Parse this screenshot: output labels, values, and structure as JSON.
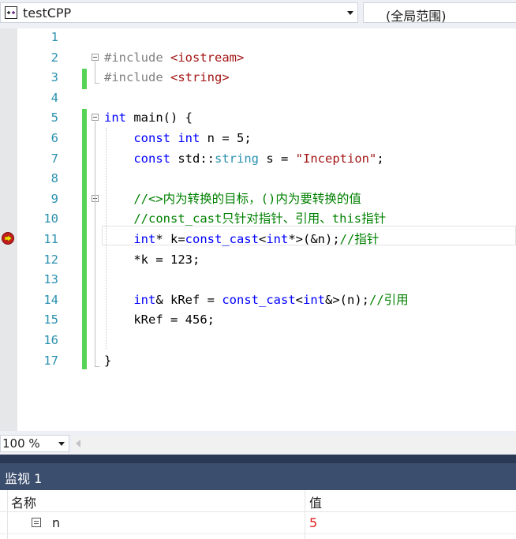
{
  "navigation": {
    "project": "testCPP",
    "scope": "(全局范围)"
  },
  "editor": {
    "lines": [
      {
        "num": "1",
        "tokens": []
      },
      {
        "num": "2",
        "tokens": [
          {
            "t": "#include ",
            "c": "p"
          },
          {
            "t": "<iostream>",
            "c": "s"
          }
        ]
      },
      {
        "num": "3",
        "tokens": [
          {
            "t": "#include ",
            "c": "p"
          },
          {
            "t": "<string>",
            "c": "s"
          }
        ]
      },
      {
        "num": "4",
        "tokens": []
      },
      {
        "num": "5",
        "tokens": [
          {
            "t": "int",
            "c": "k"
          },
          {
            "t": " main() {"
          }
        ]
      },
      {
        "num": "6",
        "tokens": [
          {
            "t": "    "
          },
          {
            "t": "const",
            "c": "k"
          },
          {
            "t": " "
          },
          {
            "t": "int",
            "c": "k"
          },
          {
            "t": " n = 5;"
          }
        ]
      },
      {
        "num": "7",
        "tokens": [
          {
            "t": "    "
          },
          {
            "t": "const",
            "c": "k"
          },
          {
            "t": " std::"
          },
          {
            "t": "string",
            "c": "t"
          },
          {
            "t": " s = "
          },
          {
            "t": "\"Inception\"",
            "c": "s"
          },
          {
            "t": ";"
          }
        ]
      },
      {
        "num": "8",
        "tokens": []
      },
      {
        "num": "9",
        "tokens": [
          {
            "t": "    "
          },
          {
            "t": "//<>内为转换的目标，()内为要转换的值",
            "c": "c"
          }
        ]
      },
      {
        "num": "10",
        "tokens": [
          {
            "t": "    "
          },
          {
            "t": "//const_cast只针对指针、引用、this指针",
            "c": "c"
          }
        ]
      },
      {
        "num": "11",
        "tokens": [
          {
            "t": "    "
          },
          {
            "t": "int",
            "c": "k"
          },
          {
            "t": "* k="
          },
          {
            "t": "const_cast",
            "c": "k"
          },
          {
            "t": "<"
          },
          {
            "t": "int",
            "c": "k"
          },
          {
            "t": "*>(&n);"
          },
          {
            "t": "//指针",
            "c": "c"
          }
        ]
      },
      {
        "num": "12",
        "tokens": [
          {
            "t": "    *k = 123;"
          }
        ]
      },
      {
        "num": "13",
        "tokens": []
      },
      {
        "num": "14",
        "tokens": [
          {
            "t": "    "
          },
          {
            "t": "int",
            "c": "k"
          },
          {
            "t": "& kRef = "
          },
          {
            "t": "const_cast",
            "c": "k"
          },
          {
            "t": "<"
          },
          {
            "t": "int",
            "c": "k"
          },
          {
            "t": "&>(n);"
          },
          {
            "t": "//引用",
            "c": "c"
          }
        ]
      },
      {
        "num": "15",
        "tokens": [
          {
            "t": "    kRef = 456;"
          }
        ]
      },
      {
        "num": "16",
        "tokens": []
      },
      {
        "num": "17",
        "tokens": [
          {
            "t": "}"
          }
        ]
      }
    ],
    "current_line": 11,
    "colors": {
      "keyword": "#0000ff",
      "type": "#2b91af",
      "string": "#a31515",
      "comment": "#008000",
      "preprocessor": "#808080",
      "line_number": "#2b91af",
      "change_bar": "#57d357"
    }
  },
  "zoom": {
    "value": "100 %"
  },
  "watch": {
    "title": "监视 1",
    "headers": {
      "name": "名称",
      "value": "值"
    },
    "rows": [
      {
        "name": "n",
        "value": "5"
      }
    ]
  }
}
